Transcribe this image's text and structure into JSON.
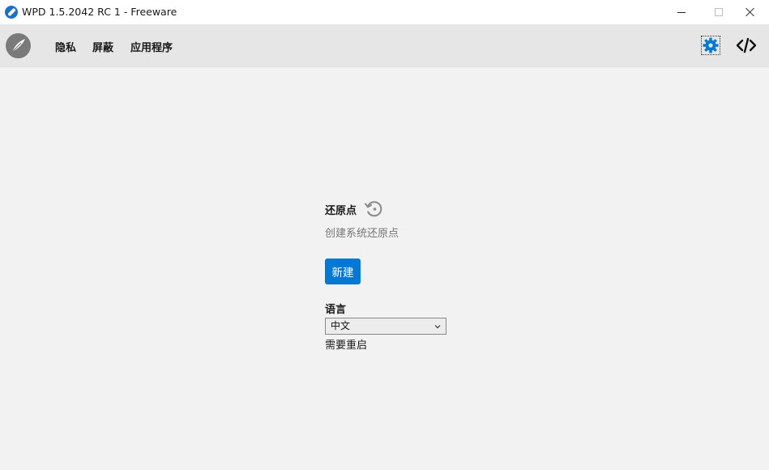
{
  "window": {
    "title": "WPD 1.5.2042 RC 1 - Freeware"
  },
  "toolbar": {
    "nav": [
      {
        "label": "隐私"
      },
      {
        "label": "屏蔽"
      },
      {
        "label": "应用程序"
      }
    ],
    "icons": [
      "logo-icon",
      "settings-gear-icon",
      "code-icon"
    ]
  },
  "restore_point": {
    "title": "还原点",
    "description": "创建系统还原点",
    "new_button_label": "新建",
    "icon": "restore-icon"
  },
  "language": {
    "label": "语言",
    "selected": "中文",
    "note": "需要重启"
  },
  "colors": {
    "accent": "#0078d4",
    "toolbar_bg": "#e6e6e6",
    "content_bg": "#f2f2f2"
  }
}
